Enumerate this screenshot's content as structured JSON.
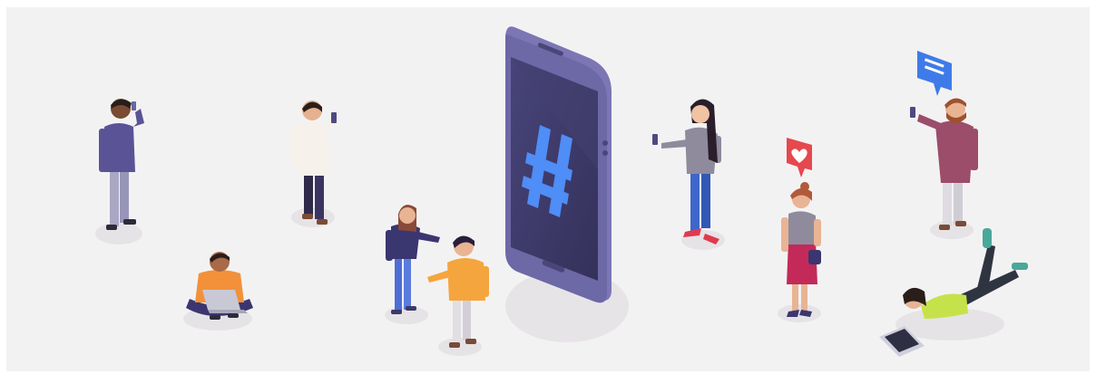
{
  "illustration": {
    "symbol": "#",
    "colors": {
      "background": "#f3f2f3",
      "phone_body": "#6f6aa8",
      "phone_screen": "#3d3a66",
      "hashtag": "#4f8df7",
      "like_badge": "#e5484d",
      "chat_badge": "#3f7be8",
      "shadow": "#e4e1e4"
    },
    "icons": [
      "smartphone-icon",
      "hashtag-icon",
      "heart-icon",
      "chat-bubble-icon",
      "laptop-icon",
      "tablet-icon"
    ]
  }
}
